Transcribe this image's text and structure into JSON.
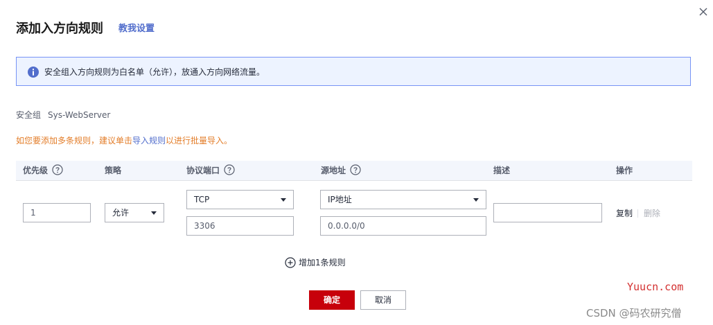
{
  "dialog": {
    "title": "添加入方向规则",
    "guide_link": "教我设置"
  },
  "info_banner": {
    "text": "安全组入方向规则为白名单（允许），放通入方向网络流量。"
  },
  "security_group": {
    "label": "安全组",
    "value": "Sys-WebServer"
  },
  "hint": {
    "before": "如您要添加多条规则，建议单击",
    "link": "导入规则",
    "after": "以进行批量导入。"
  },
  "table": {
    "headers": {
      "priority": "优先级",
      "policy": "策略",
      "protocol_port": "协议端口",
      "source": "源地址",
      "description": "描述",
      "actions": "操作"
    },
    "row": {
      "priority": "1",
      "policy": "允许",
      "protocol": "TCP",
      "port": "3306",
      "source_type": "IP地址",
      "source_value": "0.0.0.0/0",
      "description": "",
      "copy": "复制",
      "delete": "删除"
    }
  },
  "add_rule": {
    "label": "增加1条规则"
  },
  "footer": {
    "ok": "确定",
    "cancel": "取消"
  },
  "watermarks": {
    "site": "Yuucn.com",
    "csdn": "CSDN @码农研究僧"
  },
  "colors": {
    "brand_red": "#c7000b",
    "link_blue": "#526ecc",
    "hint_orange": "#e37d29",
    "info_bg": "#edf3ff",
    "info_border": "#7693f5"
  }
}
